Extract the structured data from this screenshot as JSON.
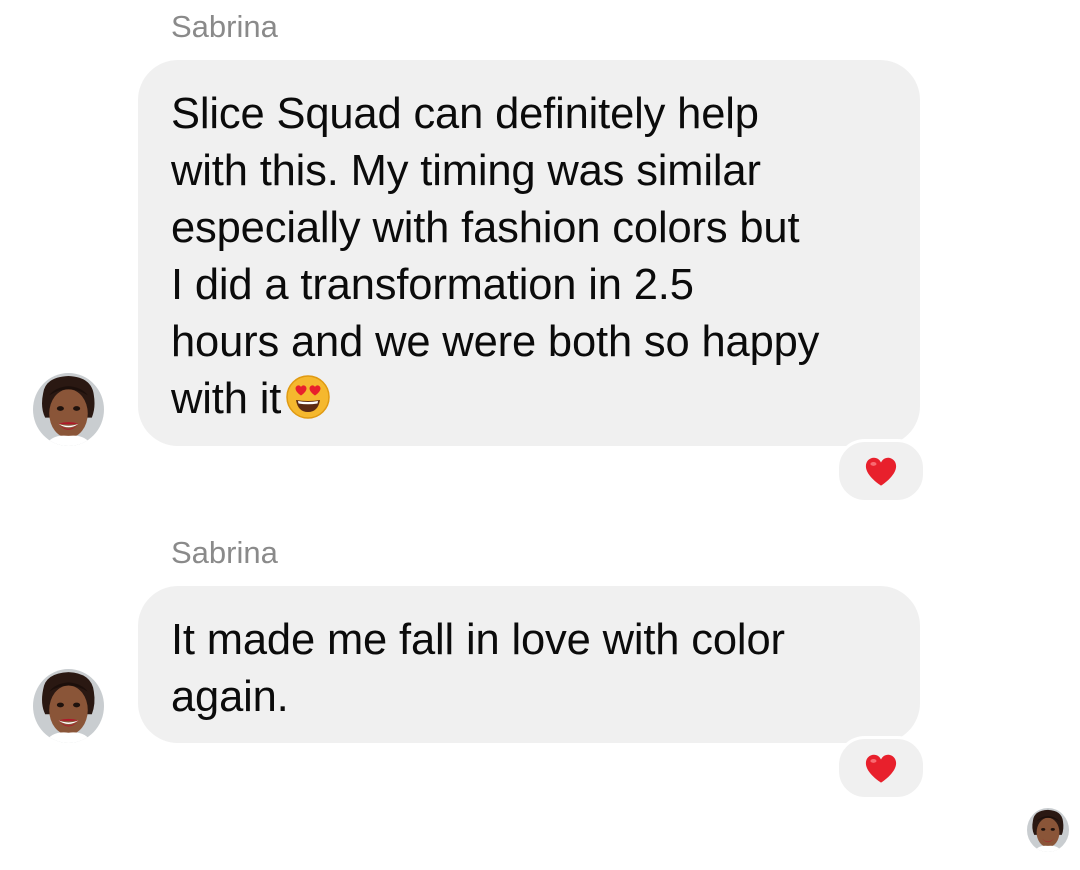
{
  "messages": [
    {
      "sender": "Sabrina",
      "text": "Slice Squad can definitely help\nwith this. My timing was similar\nespecially with fashion colors but\nI did a transformation in 2.5\nhours and we were both so happy\nwith it",
      "emoji": "heart-eyes-emoji",
      "reaction": "heart-icon"
    },
    {
      "sender": "Sabrina",
      "text": "It made me fall in love with color\nagain.",
      "reaction": "heart-icon"
    }
  ],
  "colors": {
    "bubble": "#f0f0f0",
    "sender_name": "#8a8a8a",
    "text": "#0b0b0b",
    "heart": "#e8202c",
    "emoji_face": "#f5b82e"
  }
}
